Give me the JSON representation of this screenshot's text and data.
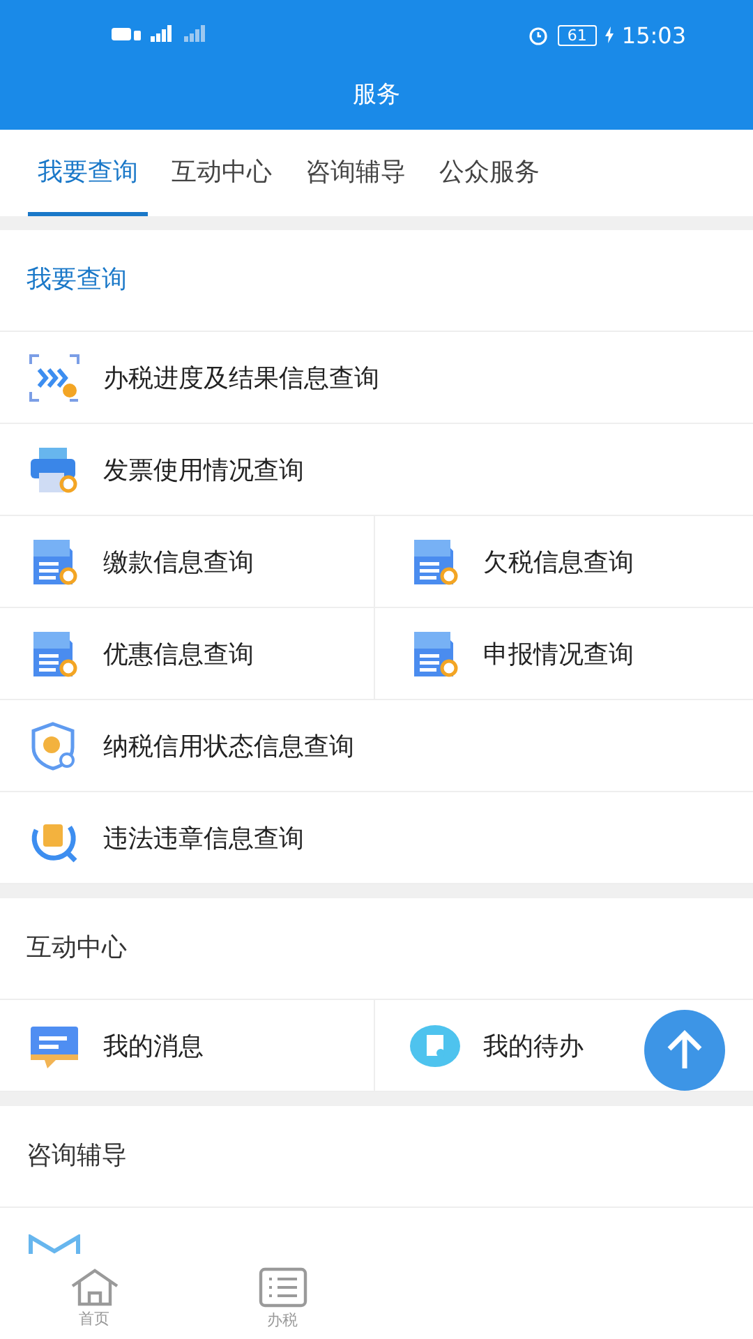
{
  "status_bar": {
    "time": "15:03",
    "battery": "61"
  },
  "header": {
    "title": "服务"
  },
  "tabs": [
    {
      "label": "我要查询",
      "selected": true
    },
    {
      "label": "互动中心",
      "selected": false
    },
    {
      "label": "咨询辅导",
      "selected": false
    },
    {
      "label": "公众服务",
      "selected": false
    }
  ],
  "sections": [
    {
      "title": "我要查询",
      "selected": true,
      "rows": [
        [
          "办税进度及结果信息查询"
        ],
        [
          "发票使用情况查询"
        ],
        [
          "缴款信息查询",
          "欠税信息查询"
        ],
        [
          "优惠信息查询",
          "申报情况查询"
        ],
        [
          "纳税信用状态信息查询"
        ],
        [
          "违法违章信息查询"
        ]
      ]
    },
    {
      "title": "互动中心",
      "selected": false,
      "rows": [
        [
          "我的消息",
          "我的待办"
        ]
      ]
    },
    {
      "title": "咨询辅导",
      "selected": false
    }
  ],
  "bottom_nav": [
    {
      "label": "首页"
    },
    {
      "label": "办税"
    }
  ]
}
